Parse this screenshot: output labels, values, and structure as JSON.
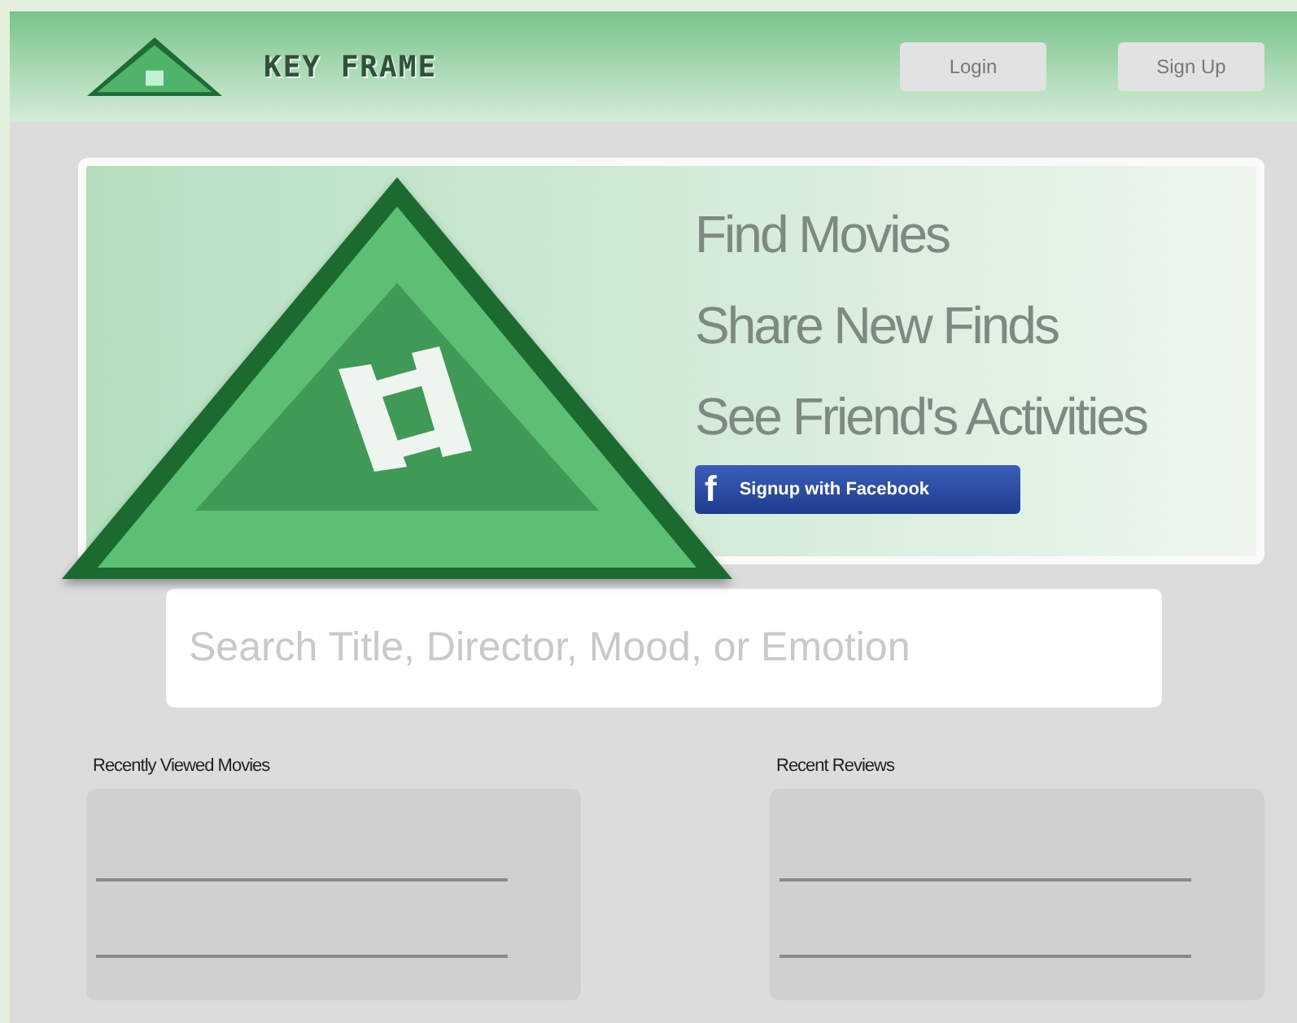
{
  "header": {
    "brand": "KEY FRAME",
    "buttons": [
      "Login",
      "Sign Up"
    ]
  },
  "hero": {
    "taglines": [
      "Find Movies",
      "Share New Finds",
      "See Friend's Activities"
    ],
    "facebook_button": {
      "icon": "f",
      "label": "Signup with Facebook"
    }
  },
  "search": {
    "placeholder": "Search Title, Director, Mood, or Emotion"
  },
  "sections": [
    {
      "title": "Recently Viewed Movies"
    },
    {
      "title": "Recent Reviews"
    }
  ]
}
